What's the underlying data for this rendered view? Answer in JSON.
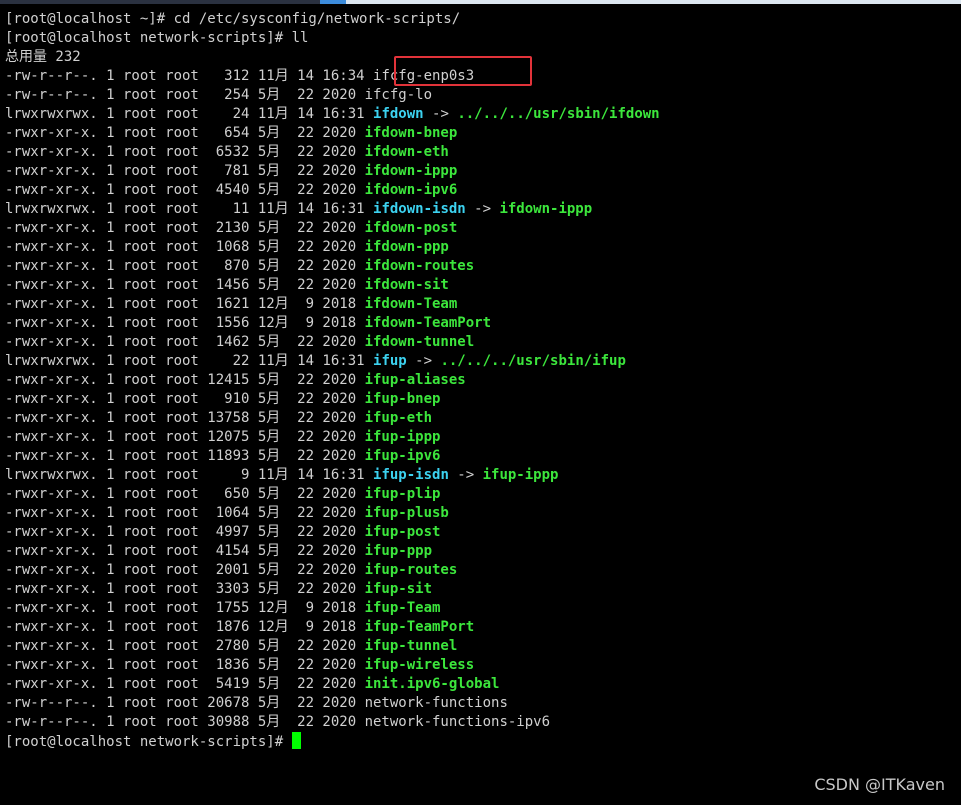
{
  "colors": {
    "background": "#000000",
    "text": "#d0d0d0",
    "executable": "#3ce63c",
    "symlink": "#3cd2f0",
    "cursor": "#00ff00",
    "highlight_box": "#e2333a",
    "topbar_dark": "#2a3140",
    "topbar_light": "#dce6f0",
    "topbar_accent": "#3c8cdc"
  },
  "commands": [
    "[root@localhost ~]# cd /etc/sysconfig/network-scripts/",
    "[root@localhost network-scripts]# ll"
  ],
  "total_line": "总用量 232",
  "listing": [
    {
      "meta": "-rw-r--r--. 1 root root   312 11月 14 16:34 ",
      "name": "ifcfg-enp0s3",
      "type": "plain"
    },
    {
      "meta": "-rw-r--r--. 1 root root   254 5月  22 2020 ",
      "name": "ifcfg-lo",
      "type": "plain"
    },
    {
      "meta": "lrwxrwxrwx. 1 root root    24 11月 14 16:31 ",
      "name": "ifdown",
      "type": "link",
      "target": "../../../usr/sbin/ifdown",
      "target_type": "exe"
    },
    {
      "meta": "-rwxr-xr-x. 1 root root   654 5月  22 2020 ",
      "name": "ifdown-bnep",
      "type": "exe"
    },
    {
      "meta": "-rwxr-xr-x. 1 root root  6532 5月  22 2020 ",
      "name": "ifdown-eth",
      "type": "exe"
    },
    {
      "meta": "-rwxr-xr-x. 1 root root   781 5月  22 2020 ",
      "name": "ifdown-ippp",
      "type": "exe"
    },
    {
      "meta": "-rwxr-xr-x. 1 root root  4540 5月  22 2020 ",
      "name": "ifdown-ipv6",
      "type": "exe"
    },
    {
      "meta": "lrwxrwxrwx. 1 root root    11 11月 14 16:31 ",
      "name": "ifdown-isdn",
      "type": "link",
      "target": "ifdown-ippp",
      "target_type": "exe"
    },
    {
      "meta": "-rwxr-xr-x. 1 root root  2130 5月  22 2020 ",
      "name": "ifdown-post",
      "type": "exe"
    },
    {
      "meta": "-rwxr-xr-x. 1 root root  1068 5月  22 2020 ",
      "name": "ifdown-ppp",
      "type": "exe"
    },
    {
      "meta": "-rwxr-xr-x. 1 root root   870 5月  22 2020 ",
      "name": "ifdown-routes",
      "type": "exe"
    },
    {
      "meta": "-rwxr-xr-x. 1 root root  1456 5月  22 2020 ",
      "name": "ifdown-sit",
      "type": "exe"
    },
    {
      "meta": "-rwxr-xr-x. 1 root root  1621 12月  9 2018 ",
      "name": "ifdown-Team",
      "type": "exe"
    },
    {
      "meta": "-rwxr-xr-x. 1 root root  1556 12月  9 2018 ",
      "name": "ifdown-TeamPort",
      "type": "exe"
    },
    {
      "meta": "-rwxr-xr-x. 1 root root  1462 5月  22 2020 ",
      "name": "ifdown-tunnel",
      "type": "exe"
    },
    {
      "meta": "lrwxrwxrwx. 1 root root    22 11月 14 16:31 ",
      "name": "ifup",
      "type": "link",
      "target": "../../../usr/sbin/ifup",
      "target_type": "exe"
    },
    {
      "meta": "-rwxr-xr-x. 1 root root 12415 5月  22 2020 ",
      "name": "ifup-aliases",
      "type": "exe"
    },
    {
      "meta": "-rwxr-xr-x. 1 root root   910 5月  22 2020 ",
      "name": "ifup-bnep",
      "type": "exe"
    },
    {
      "meta": "-rwxr-xr-x. 1 root root 13758 5月  22 2020 ",
      "name": "ifup-eth",
      "type": "exe"
    },
    {
      "meta": "-rwxr-xr-x. 1 root root 12075 5月  22 2020 ",
      "name": "ifup-ippp",
      "type": "exe"
    },
    {
      "meta": "-rwxr-xr-x. 1 root root 11893 5月  22 2020 ",
      "name": "ifup-ipv6",
      "type": "exe"
    },
    {
      "meta": "lrwxrwxrwx. 1 root root     9 11月 14 16:31 ",
      "name": "ifup-isdn",
      "type": "link",
      "target": "ifup-ippp",
      "target_type": "exe"
    },
    {
      "meta": "-rwxr-xr-x. 1 root root   650 5月  22 2020 ",
      "name": "ifup-plip",
      "type": "exe"
    },
    {
      "meta": "-rwxr-xr-x. 1 root root  1064 5月  22 2020 ",
      "name": "ifup-plusb",
      "type": "exe"
    },
    {
      "meta": "-rwxr-xr-x. 1 root root  4997 5月  22 2020 ",
      "name": "ifup-post",
      "type": "exe"
    },
    {
      "meta": "-rwxr-xr-x. 1 root root  4154 5月  22 2020 ",
      "name": "ifup-ppp",
      "type": "exe"
    },
    {
      "meta": "-rwxr-xr-x. 1 root root  2001 5月  22 2020 ",
      "name": "ifup-routes",
      "type": "exe"
    },
    {
      "meta": "-rwxr-xr-x. 1 root root  3303 5月  22 2020 ",
      "name": "ifup-sit",
      "type": "exe"
    },
    {
      "meta": "-rwxr-xr-x. 1 root root  1755 12月  9 2018 ",
      "name": "ifup-Team",
      "type": "exe"
    },
    {
      "meta": "-rwxr-xr-x. 1 root root  1876 12月  9 2018 ",
      "name": "ifup-TeamPort",
      "type": "exe"
    },
    {
      "meta": "-rwxr-xr-x. 1 root root  2780 5月  22 2020 ",
      "name": "ifup-tunnel",
      "type": "exe"
    },
    {
      "meta": "-rwxr-xr-x. 1 root root  1836 5月  22 2020 ",
      "name": "ifup-wireless",
      "type": "exe"
    },
    {
      "meta": "-rwxr-xr-x. 1 root root  5419 5月  22 2020 ",
      "name": "init.ipv6-global",
      "type": "exe"
    },
    {
      "meta": "-rw-r--r--. 1 root root 20678 5月  22 2020 ",
      "name": "network-functions",
      "type": "plain"
    },
    {
      "meta": "-rw-r--r--. 1 root root 30988 5月  22 2020 ",
      "name": "network-functions-ipv6",
      "type": "plain"
    }
  ],
  "final_prompt": "[root@localhost network-scripts]# ",
  "watermark": "CSDN @ITKaven"
}
